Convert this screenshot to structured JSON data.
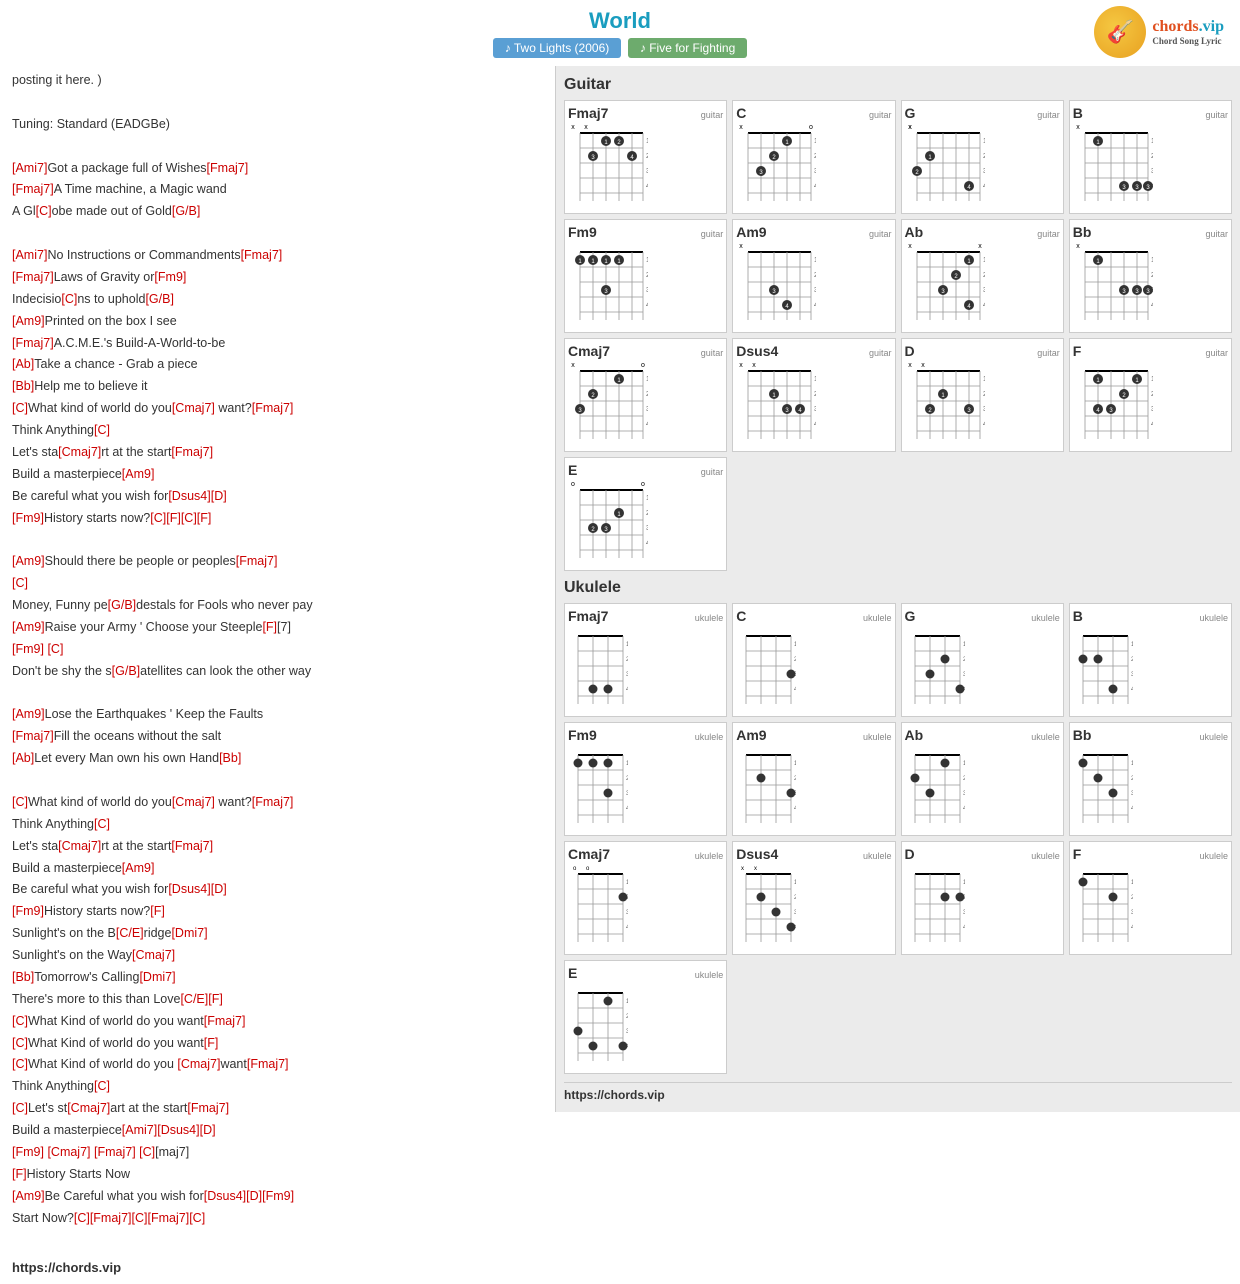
{
  "header": {
    "title": "World",
    "tabs": [
      {
        "label": "Two Lights (2006)",
        "type": "album",
        "icon": "♪"
      },
      {
        "label": "Five for Fighting",
        "type": "artist",
        "icon": "♪"
      }
    ]
  },
  "lyrics": {
    "tuning": "Tuning: Standard (EADGBe)",
    "lines": [
      "posting it here. )",
      "",
      "Tuning: Standard (EADGBe)",
      "",
      "[Ami7]Got a package full of Wishes[Fmaj7]",
      "[Fmaj7]A Time machine, a Magic wand",
      "A Gl[C]obe made out of Gold[G/B]",
      "",
      "[Ami7]No Instructions or Commandments[Fmaj7]",
      "[Fmaj7]Laws of Gravity or[Fm9]",
      "Indecisio[C]ns to uphold[G/B]",
      "[Am9]Printed on the box I see",
      "[Fmaj7]A.C.M.E.'s Build-A-World-to-be",
      "[Ab]Take a chance - Grab a piece",
      "[Bb]Help me to believe it",
      "[C]What kind of world do you[Cmaj7] want?[Fmaj7]",
      "Think Anything[C]",
      "Let's sta[Cmaj7]rt at the start[Fmaj7]",
      "Build a masterpiece[Am9]",
      "Be careful what you wish for[Dsus4][D]",
      "[Fm9]History starts now?[C][F][C][F]",
      "",
      "[Am9]Should there be people or peoples[Fmaj7]",
      "[C]",
      "Money, Funny pe[G/B]destals for Fools who never pay",
      "[Am9]Raise your Army ' Choose your Steeple[F][7]",
      "[Fm9] [C]",
      "Don't be shy the s[G/B]atellites can look the other way",
      "",
      "[Am9]Lose the Earthquakes ' Keep the Faults",
      "[Fmaj7]Fill the oceans without the salt",
      "[Ab]Let every Man own his own Hand[Bb]",
      "",
      "[C]What kind of world do you[Cmaj7] want?[Fmaj7]",
      "Think Anything[C]",
      "Let's sta[Cmaj7]rt at the start[Fmaj7]",
      "Build a masterpiece[Am9]",
      "Be careful what you wish for[Dsus4][D]",
      "[Fm9]History starts now?[F]",
      "Sunlight's on the B[C/E]ridge[Dmi7]",
      "Sunlight's on the Way[Cmaj7]",
      "[Bb]Tomorrow's Calling[Dmi7]",
      "There's more to this than Love[C/E][F]",
      "[C]What Kind of world do you want[Fmaj7]",
      "[C]What Kind of world do you want[F]",
      "[C]What Kind of world do you [Cmaj7]want[Fmaj7]",
      "Think Anything[C]",
      "[C]Let's st[Cmaj7]art at the start[Fmaj7]",
      "Build a masterpiece[Ami7][Dsus4][D]",
      "[Fm9] [Cmaj7] [Fmaj7] [C][maj7]",
      "[F]History Starts Now",
      "[Am9]Be Careful what you wish for[Dsus4][D][Fm9]",
      "Start Now?[C][Fmaj7][C][Fmaj7][C]"
    ]
  },
  "footer_url": "https://chords.vip",
  "guitar_section_title": "Guitar",
  "ukulele_section_title": "Ukulele",
  "chords_footer_url": "https://chords.vip",
  "guitar_chords": [
    {
      "name": "Fmaj7",
      "type": "guitar"
    },
    {
      "name": "C",
      "type": "guitar"
    },
    {
      "name": "G",
      "type": "guitar"
    },
    {
      "name": "B",
      "type": "guitar"
    },
    {
      "name": "Fm9",
      "type": "guitar"
    },
    {
      "name": "Am9",
      "type": "guitar"
    },
    {
      "name": "Ab",
      "type": "guitar"
    },
    {
      "name": "Bb",
      "type": "guitar"
    },
    {
      "name": "Cmaj7",
      "type": "guitar"
    },
    {
      "name": "Dsus4",
      "type": "guitar"
    },
    {
      "name": "D",
      "type": "guitar"
    },
    {
      "name": "F",
      "type": "guitar"
    },
    {
      "name": "E",
      "type": "guitar",
      "single": true
    }
  ],
  "ukulele_chords": [
    {
      "name": "Fmaj7",
      "type": "ukulele"
    },
    {
      "name": "C",
      "type": "ukulele"
    },
    {
      "name": "G",
      "type": "ukulele"
    },
    {
      "name": "B",
      "type": "ukulele"
    },
    {
      "name": "Fm9",
      "type": "ukulele"
    },
    {
      "name": "Am9",
      "type": "ukulele"
    },
    {
      "name": "Ab",
      "type": "ukulele"
    },
    {
      "name": "Bb",
      "type": "ukulele"
    },
    {
      "name": "Cmaj7",
      "type": "ukulele"
    },
    {
      "name": "Dsus4",
      "type": "ukulele"
    },
    {
      "name": "D",
      "type": "ukulele"
    },
    {
      "name": "F",
      "type": "ukulele"
    },
    {
      "name": "E",
      "type": "ukulele",
      "single": true
    }
  ]
}
